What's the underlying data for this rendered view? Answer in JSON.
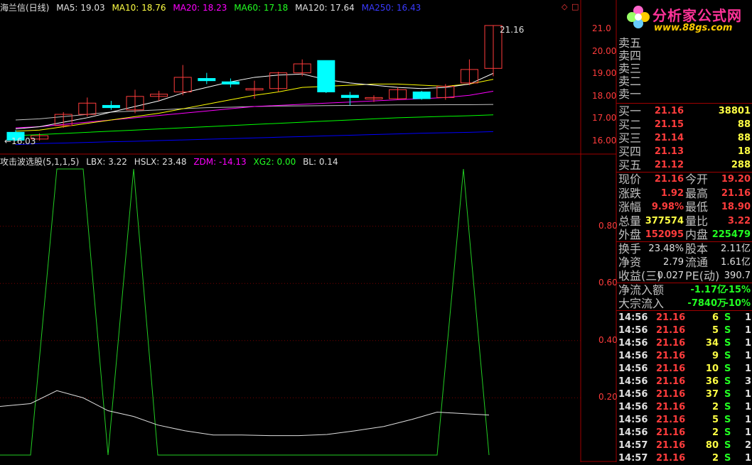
{
  "main_header": {
    "title": "海兰信(日线)",
    "ma5": "MA5: 19.03",
    "ma10": "MA10: 18.76",
    "ma20": "MA20: 18.23",
    "ma60": "MA60: 17.18",
    "ma120": "MA120: 17.64",
    "ma250": "MA250: 16.43"
  },
  "indicator_header": {
    "name": "攻击波选股(5,1,1,5)",
    "lbx": "LBX: 3.22",
    "hslx": "HSLX: 23.48",
    "zdm": "ZDM: -14.13",
    "xg2": "XG2: 0.00",
    "bl": "BL: 0.14"
  },
  "price_axis": [
    "21.0",
    "20.00",
    "19.00",
    "18.00",
    "17.00",
    "16.00"
  ],
  "indicator_axis": [
    "0.80",
    "0.60",
    "0.40",
    "0.20"
  ],
  "annotations": {
    "high_label": "21.16",
    "low_label": "←16.03"
  },
  "logo": {
    "name": "分析家公式网",
    "url": "www.88gs.com"
  },
  "colors": {
    "up": "#ff3c3c",
    "down": "#00ffff",
    "ma5": "#ffffff",
    "ma10": "#ffff00",
    "ma20": "#ff00ff",
    "ma60": "#00ff00",
    "ma120": "#c0c0c0",
    "ma250": "#0000ff",
    "frame": "#a00000"
  },
  "sell_orders": [
    {
      "label": "卖五"
    },
    {
      "label": "卖四"
    },
    {
      "label": "卖三"
    },
    {
      "label": "卖二"
    },
    {
      "label": "卖一"
    }
  ],
  "buy_orders": [
    {
      "label": "买一",
      "price": "21.16",
      "volume": "38801"
    },
    {
      "label": "买二",
      "price": "21.15",
      "volume": "88"
    },
    {
      "label": "买三",
      "price": "21.14",
      "volume": "88"
    },
    {
      "label": "买四",
      "price": "21.13",
      "volume": "18"
    },
    {
      "label": "买五",
      "price": "21.12",
      "volume": "288"
    }
  ],
  "quote": [
    {
      "l1": "现价",
      "v1": "21.16",
      "l2": "今开",
      "v2": "19.20",
      "c1": "red",
      "c2": "red"
    },
    {
      "l1": "涨跌",
      "v1": "1.92",
      "l2": "最高",
      "v2": "21.16",
      "c1": "red",
      "c2": "red"
    },
    {
      "l1": "涨幅",
      "v1": "9.98%",
      "l2": "最低",
      "v2": "18.90",
      "c1": "red",
      "c2": "red"
    },
    {
      "l1": "总量",
      "v1": "377574",
      "l2": "量比",
      "v2": "3.22",
      "c1": "yel",
      "c2": "red"
    },
    {
      "l1": "外盘",
      "v1": "152095",
      "l2": "内盘",
      "v2": "225479",
      "c1": "red",
      "c2": "grn"
    }
  ],
  "fundamentals": [
    {
      "l1": "换手",
      "v1": "23.48%",
      "l2": "股本",
      "v2": "2.11亿"
    },
    {
      "l1": "净资",
      "v1": "2.79",
      "l2": "流通",
      "v2": "1.61亿"
    },
    {
      "l1": "收益(三)",
      "v1": "0.027",
      "l2": "PE(动)",
      "v2": "390.7"
    }
  ],
  "flows": [
    {
      "label": "净流入额",
      "value": "-1.17亿",
      "pct": "-15%"
    },
    {
      "label": "大宗流入",
      "value": "-7840万",
      "pct": "-10%"
    }
  ],
  "ticks": [
    {
      "time": "14:56",
      "price": "21.16",
      "vol": "6",
      "side": "S",
      "n": "1"
    },
    {
      "time": "14:56",
      "price": "21.16",
      "vol": "5",
      "side": "S",
      "n": "1"
    },
    {
      "time": "14:56",
      "price": "21.16",
      "vol": "34",
      "side": "S",
      "n": "1"
    },
    {
      "time": "14:56",
      "price": "21.16",
      "vol": "9",
      "side": "S",
      "n": "1"
    },
    {
      "time": "14:56",
      "price": "21.16",
      "vol": "10",
      "side": "S",
      "n": "1"
    },
    {
      "time": "14:56",
      "price": "21.16",
      "vol": "36",
      "side": "S",
      "n": "3"
    },
    {
      "time": "14:56",
      "price": "21.16",
      "vol": "37",
      "side": "S",
      "n": "1"
    },
    {
      "time": "14:56",
      "price": "21.16",
      "vol": "2",
      "side": "S",
      "n": "1"
    },
    {
      "time": "14:56",
      "price": "21.16",
      "vol": "5",
      "side": "S",
      "n": "1"
    },
    {
      "time": "14:56",
      "price": "21.16",
      "vol": "2",
      "side": "S",
      "n": "1"
    },
    {
      "time": "14:57",
      "price": "21.16",
      "vol": "80",
      "side": "S",
      "n": "2"
    },
    {
      "time": "14:57",
      "price": "21.16",
      "vol": "2",
      "side": "S",
      "n": "1"
    }
  ],
  "candles": [
    {
      "o": 16.05,
      "c": 16.4,
      "h": 16.5,
      "l": 16.0,
      "dir": "down"
    },
    {
      "o": 16.1,
      "c": 16.25,
      "h": 16.35,
      "l": 16.03,
      "dir": "up"
    },
    {
      "o": 16.7,
      "c": 17.2,
      "h": 17.3,
      "l": 16.6,
      "dir": "up"
    },
    {
      "o": 17.2,
      "c": 17.7,
      "h": 17.95,
      "l": 17.1,
      "dir": "up"
    },
    {
      "o": 17.5,
      "c": 17.6,
      "h": 17.8,
      "l": 17.4,
      "dir": "down"
    },
    {
      "o": 17.4,
      "c": 18.0,
      "h": 18.3,
      "l": 17.25,
      "dir": "up"
    },
    {
      "o": 18.0,
      "c": 18.1,
      "h": 18.25,
      "l": 17.8,
      "dir": "up"
    },
    {
      "o": 18.2,
      "c": 18.85,
      "h": 19.4,
      "l": 18.05,
      "dir": "up"
    },
    {
      "o": 18.7,
      "c": 18.8,
      "h": 19.05,
      "l": 18.55,
      "dir": "down"
    },
    {
      "o": 18.65,
      "c": 18.55,
      "h": 18.8,
      "l": 18.4,
      "dir": "down"
    },
    {
      "o": 18.3,
      "c": 18.35,
      "h": 18.7,
      "l": 17.9,
      "dir": "up"
    },
    {
      "o": 18.35,
      "c": 19.05,
      "h": 19.1,
      "l": 18.2,
      "dir": "up"
    },
    {
      "o": 19.05,
      "c": 19.45,
      "h": 19.65,
      "l": 18.9,
      "dir": "up"
    },
    {
      "o": 19.6,
      "c": 18.2,
      "h": 19.6,
      "l": 18.15,
      "dir": "down"
    },
    {
      "o": 18.05,
      "c": 17.95,
      "h": 18.2,
      "l": 17.6,
      "dir": "down"
    },
    {
      "o": 17.9,
      "c": 17.95,
      "h": 18.05,
      "l": 17.75,
      "dir": "up"
    },
    {
      "o": 17.9,
      "c": 18.3,
      "h": 18.4,
      "l": 17.85,
      "dir": "up"
    },
    {
      "o": 18.2,
      "c": 17.9,
      "h": 18.25,
      "l": 17.85,
      "dir": "down"
    },
    {
      "o": 17.95,
      "c": 18.45,
      "h": 18.55,
      "l": 17.85,
      "dir": "up"
    },
    {
      "o": 18.6,
      "c": 19.2,
      "h": 19.65,
      "l": 18.5,
      "dir": "up"
    },
    {
      "o": 19.25,
      "c": 21.16,
      "h": 21.16,
      "l": 18.9,
      "dir": "up"
    }
  ],
  "ma_lines": {
    "ma5": [
      16.55,
      16.65,
      16.85,
      17.05,
      17.3,
      17.55,
      17.8,
      18.15,
      18.4,
      18.65,
      18.85,
      18.95,
      19.0,
      18.75,
      18.6,
      18.5,
      18.4,
      18.35,
      18.4,
      18.55,
      19.03
    ],
    "ma10": [
      16.45,
      16.5,
      16.65,
      16.8,
      16.95,
      17.1,
      17.25,
      17.45,
      17.65,
      17.85,
      18.05,
      18.2,
      18.4,
      18.45,
      18.5,
      18.55,
      18.55,
      18.5,
      18.45,
      18.55,
      18.76
    ],
    "ma20": [
      16.6,
      16.65,
      16.75,
      16.85,
      16.95,
      17.05,
      17.15,
      17.25,
      17.35,
      17.45,
      17.55,
      17.6,
      17.65,
      17.7,
      17.75,
      17.8,
      17.85,
      17.9,
      17.95,
      18.05,
      18.23
    ],
    "ma60": [
      16.25,
      16.3,
      16.35,
      16.4,
      16.45,
      16.5,
      16.55,
      16.6,
      16.65,
      16.7,
      16.75,
      16.8,
      16.85,
      16.9,
      16.95,
      17.0,
      17.05,
      17.08,
      17.11,
      17.14,
      17.18
    ],
    "ma120": [
      16.95,
      17.0,
      17.1,
      17.2,
      17.3,
      17.35,
      17.4,
      17.45,
      17.5,
      17.52,
      17.55,
      17.57,
      17.58,
      17.59,
      17.6,
      17.61,
      17.62,
      17.62,
      17.63,
      17.63,
      17.64
    ],
    "ma250": [
      15.85,
      15.9,
      15.92,
      15.95,
      15.98,
      16.0,
      16.03,
      16.06,
      16.09,
      16.12,
      16.15,
      16.18,
      16.21,
      16.24,
      16.27,
      16.3,
      16.33,
      16.36,
      16.38,
      16.4,
      16.43
    ]
  },
  "indicator": {
    "green": [
      0.0,
      0.0,
      1.0,
      1.0,
      0.0,
      1.0,
      0.0,
      0.0,
      0.0,
      0.0,
      0.0,
      0.0,
      0.0,
      0.0,
      0.0,
      0.0,
      0.0,
      0.0,
      0.0,
      0.0,
      1.0,
      0.0
    ],
    "green_x": [
      0,
      43,
      80,
      117,
      152,
      188,
      222,
      260,
      300,
      340,
      380,
      420,
      460,
      500,
      540,
      580,
      615,
      615,
      615,
      615,
      652,
      688
    ],
    "white": [
      0.17,
      0.18,
      0.225,
      0.2,
      0.155,
      0.135,
      0.105,
      0.085,
      0.07,
      0.07,
      0.068,
      0.068,
      0.072,
      0.085,
      0.1,
      0.125,
      0.15,
      0.145,
      0.14
    ],
    "white_x": [
      0,
      43,
      80,
      117,
      152,
      188,
      222,
      260,
      300,
      340,
      380,
      420,
      460,
      500,
      540,
      580,
      615,
      652,
      688
    ]
  }
}
